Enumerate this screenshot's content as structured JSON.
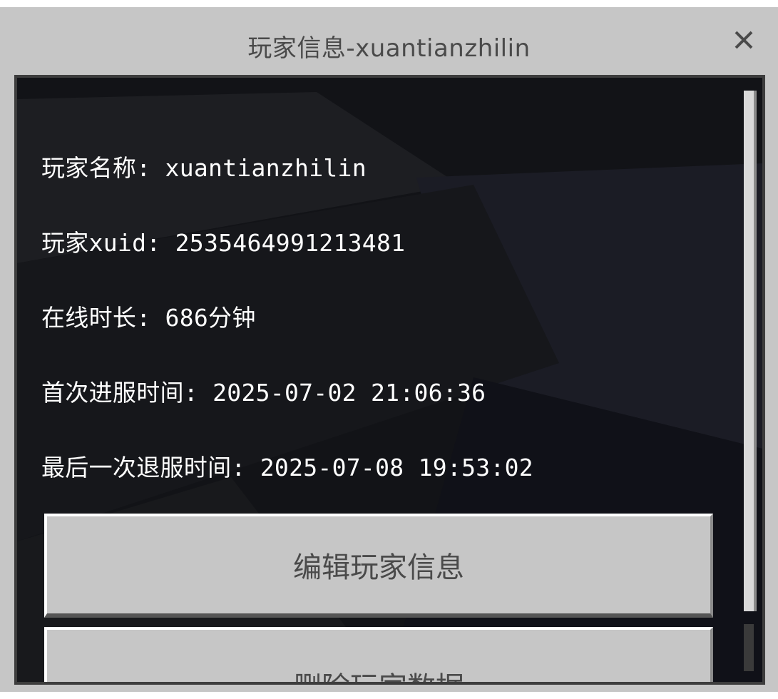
{
  "dialog": {
    "title": "玩家信息-xuantianzhilin",
    "close_icon": "close-icon"
  },
  "info": {
    "player_name": "玩家名称: xuantianzhilin",
    "player_xuid": "玩家xuid: 2535464991213481",
    "online_time": "在线时长: 686分钟",
    "first_join": "首次进服时间: 2025-07-02 21:06:36",
    "last_leave": "最后一次退服时间: 2025-07-08 19:53:02"
  },
  "buttons": {
    "edit_label": "编辑玩家信息",
    "delete_label": "删除玩家数据"
  },
  "colors": {
    "panel_bg": "#c6c6c6",
    "content_bg": "#121317",
    "text_light": "#ffffff",
    "text_dark": "#4a4a4a"
  }
}
